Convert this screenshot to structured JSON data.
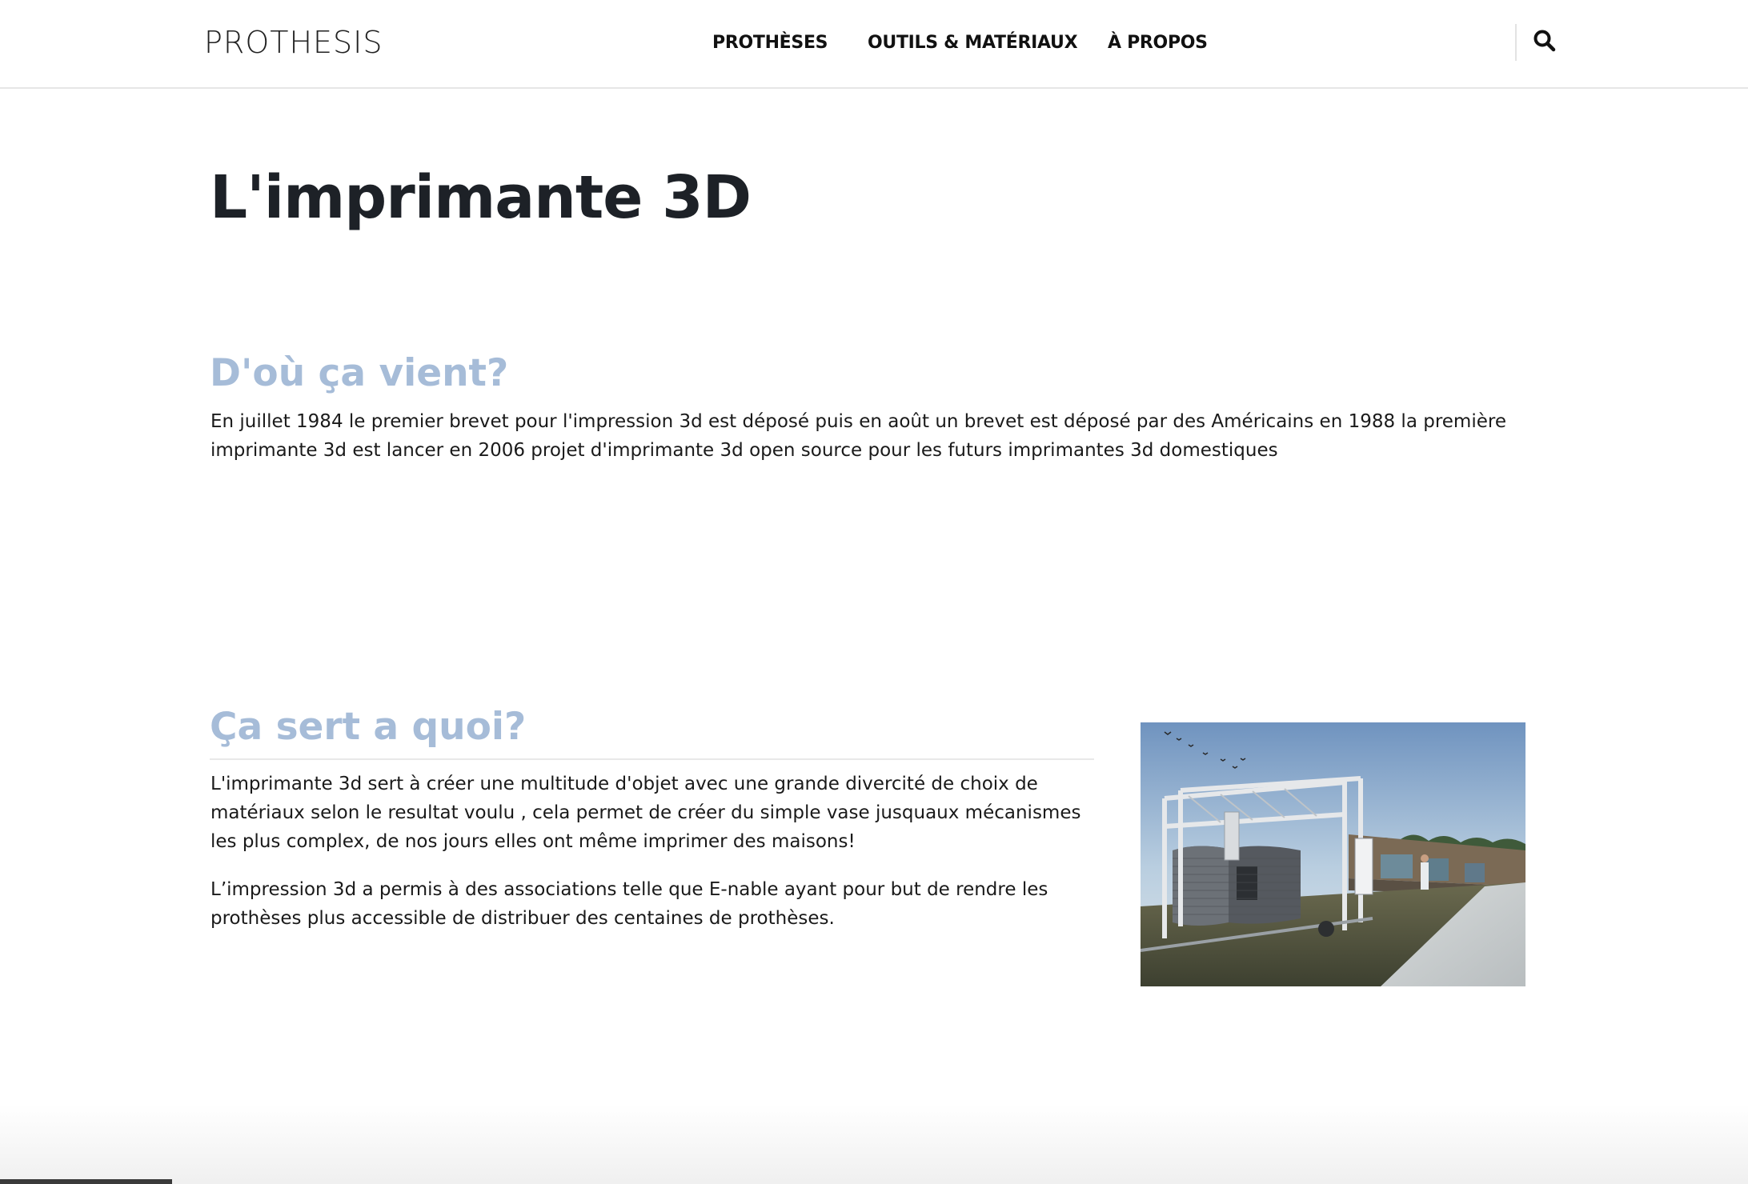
{
  "header": {
    "logo_text": "PROTHESIS",
    "nav": [
      {
        "label": "PROTHÈSES"
      },
      {
        "label": "OUTILS & MATÉRIAUX"
      },
      {
        "label": "À PROPOS"
      }
    ],
    "search_icon": "search-icon"
  },
  "page": {
    "title": "L'imprimante 3D"
  },
  "sections": {
    "origin": {
      "heading": "D'où ça vient?",
      "text": "En juillet 1984 le premier brevet pour l'impression 3d est déposé puis en août un brevet est déposé par des Américains en 1988 la première imprimante 3d est lancer en 2006 projet d'imprimante 3d open source pour les futurs imprimantes 3d domestiques"
    },
    "use": {
      "heading": "Ça sert a quoi?",
      "paragraphs": [
        "L'imprimante 3d sert à créer une multitude d'objet avec une grande divercité de choix de matériaux selon le resultat voulu , cela permet de créer du simple vase jusquaux mécanismes les plus complex, de nos jours elles ont même imprimer des maisons!",
        "L’impression 3d a permis à des associations telle que E-nable ayant pour but de rendre les prothèses plus accessible de distribuer des centaines de prothèses."
      ],
      "image_icon": "3d-house-printer-photo"
    }
  },
  "colors": {
    "heading_accent": "#a6bcd8",
    "title": "#1d2127",
    "text": "#1a1a1a"
  }
}
